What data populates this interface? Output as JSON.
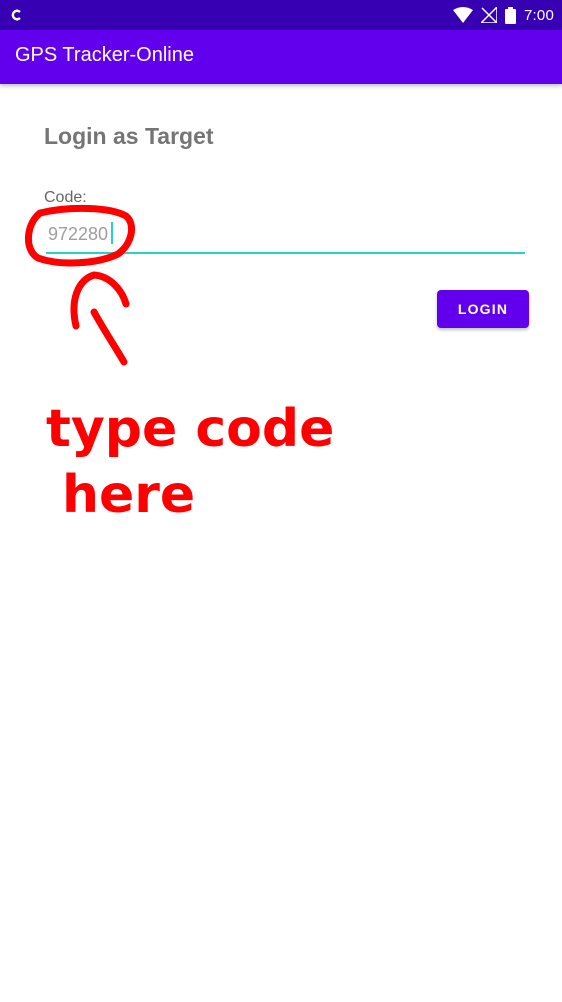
{
  "status_bar": {
    "time": "7:00",
    "icons": [
      "notification-icon",
      "wifi-icon",
      "signal-icon",
      "battery-icon"
    ]
  },
  "app_bar": {
    "title": "GPS Tracker-Online",
    "color": "#6200ee"
  },
  "colors": {
    "status_bar": "#3700b3",
    "primary": "#6200ee",
    "input_accent": "#26d3c4",
    "annotation": "#ff0000"
  },
  "login_form": {
    "heading": "Login as Target",
    "code_label": "Code:",
    "code_value": "972280",
    "login_button_label": "LOGIN"
  },
  "annotation": {
    "text_line1": "type code",
    "text_line2": "here"
  }
}
